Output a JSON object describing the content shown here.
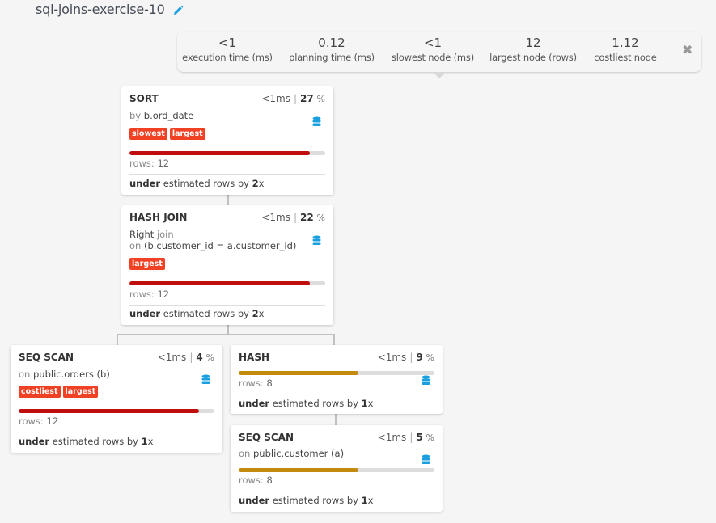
{
  "header": {
    "title": "sql-joins-exercise-10",
    "edit_icon": "pencil-icon"
  },
  "summary": {
    "stats": [
      {
        "value": "<1",
        "label": "execution time (ms)"
      },
      {
        "value": "0.12",
        "label": "planning time (ms)"
      },
      {
        "value": "<1",
        "label": "slowest node (ms)"
      },
      {
        "value": "12",
        "label": "largest node (rows)"
      },
      {
        "value": "1.12",
        "label": "costliest node"
      }
    ],
    "close_icon": "close-icon"
  },
  "colors": {
    "tag": "#f04124",
    "bar_red": "#c00d0d",
    "bar_amber": "#c48a0e",
    "db_icon": "#1aa0e0"
  },
  "nodes": [
    {
      "type": "SORT",
      "time": "<1ms",
      "percent": "27",
      "desc_prefix": "by ",
      "desc": "b.ord_date",
      "tags": [
        "slowest",
        "largest"
      ],
      "bar_fraction": 0.92,
      "bar_color": "red",
      "rows_label": "rows: ",
      "rows": "12",
      "estimate_direction": "under",
      "estimate_text": " estimated rows by ",
      "estimate_factor": "2",
      "estimate_suffix": "x"
    },
    {
      "type": "HASH JOIN",
      "time": "<1ms",
      "percent": "22",
      "join_type": "Right",
      "join_word": " join",
      "desc_prefix": "on ",
      "desc": "(b.customer_id = a.customer_id)",
      "tags": [
        "largest"
      ],
      "bar_fraction": 0.92,
      "bar_color": "red",
      "rows_label": "rows: ",
      "rows": "12",
      "estimate_direction": "under",
      "estimate_text": " estimated rows by ",
      "estimate_factor": "2",
      "estimate_suffix": "x"
    },
    {
      "type": "SEQ SCAN",
      "time": "<1ms",
      "percent": "4",
      "desc_prefix": "on ",
      "desc": "public.orders (b)",
      "tags": [
        "costliest",
        "largest"
      ],
      "bar_fraction": 0.92,
      "bar_color": "red",
      "rows_label": "rows: ",
      "rows": "12",
      "estimate_direction": "under",
      "estimate_text": " estimated rows by ",
      "estimate_factor": "1",
      "estimate_suffix": "x"
    },
    {
      "type": "HASH",
      "time": "<1ms",
      "percent": "9",
      "tags": [],
      "bar_fraction": 0.61,
      "bar_color": "amber",
      "rows_label": "rows: ",
      "rows": "8",
      "estimate_direction": "under",
      "estimate_text": " estimated rows by ",
      "estimate_factor": "1",
      "estimate_suffix": "x"
    },
    {
      "type": "SEQ SCAN",
      "time": "<1ms",
      "percent": "5",
      "desc_prefix": "on ",
      "desc": "public.customer (a)",
      "tags": [],
      "bar_fraction": 0.61,
      "bar_color": "amber",
      "rows_label": "rows: ",
      "rows": "8",
      "estimate_direction": "under",
      "estimate_text": " estimated rows by ",
      "estimate_factor": "1",
      "estimate_suffix": "x"
    }
  ]
}
